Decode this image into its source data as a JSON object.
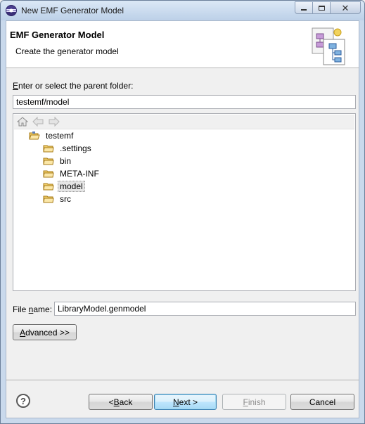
{
  "window": {
    "title": "New EMF Generator Model"
  },
  "header": {
    "title": "EMF Generator Model",
    "description": "Create the generator model"
  },
  "parent_folder": {
    "label_mnemonic": "E",
    "label_rest": "nter or select the parent folder:",
    "value": "testemf/model"
  },
  "tree": {
    "toolbar_icons": [
      "home-icon",
      "back-arrow-icon",
      "forward-arrow-icon"
    ],
    "root": {
      "label": "testemf",
      "expanded": true
    },
    "children": [
      {
        "label": ".settings",
        "selected": false
      },
      {
        "label": "bin",
        "selected": false
      },
      {
        "label": "META-INF",
        "selected": false
      },
      {
        "label": "model",
        "selected": true
      },
      {
        "label": "src",
        "selected": false
      }
    ]
  },
  "file_name": {
    "label_prefix": "File ",
    "label_mnemonic": "n",
    "label_suffix": "ame:",
    "value": "LibraryModel.genmodel"
  },
  "advanced_button": {
    "mnemonic": "A",
    "rest": "dvanced >>"
  },
  "buttons": {
    "back": {
      "prefix": "< ",
      "mnemonic": "B",
      "rest": "ack"
    },
    "next": {
      "mnemonic": "N",
      "rest": "ext >"
    },
    "finish": {
      "mnemonic": "F",
      "rest": "inish"
    },
    "cancel": "Cancel"
  },
  "help": {
    "glyph": "?"
  },
  "colors": {
    "selection_bg": "#e5e5e5",
    "default_button_border": "#3c7fb1",
    "folder": "#e8b84a"
  }
}
